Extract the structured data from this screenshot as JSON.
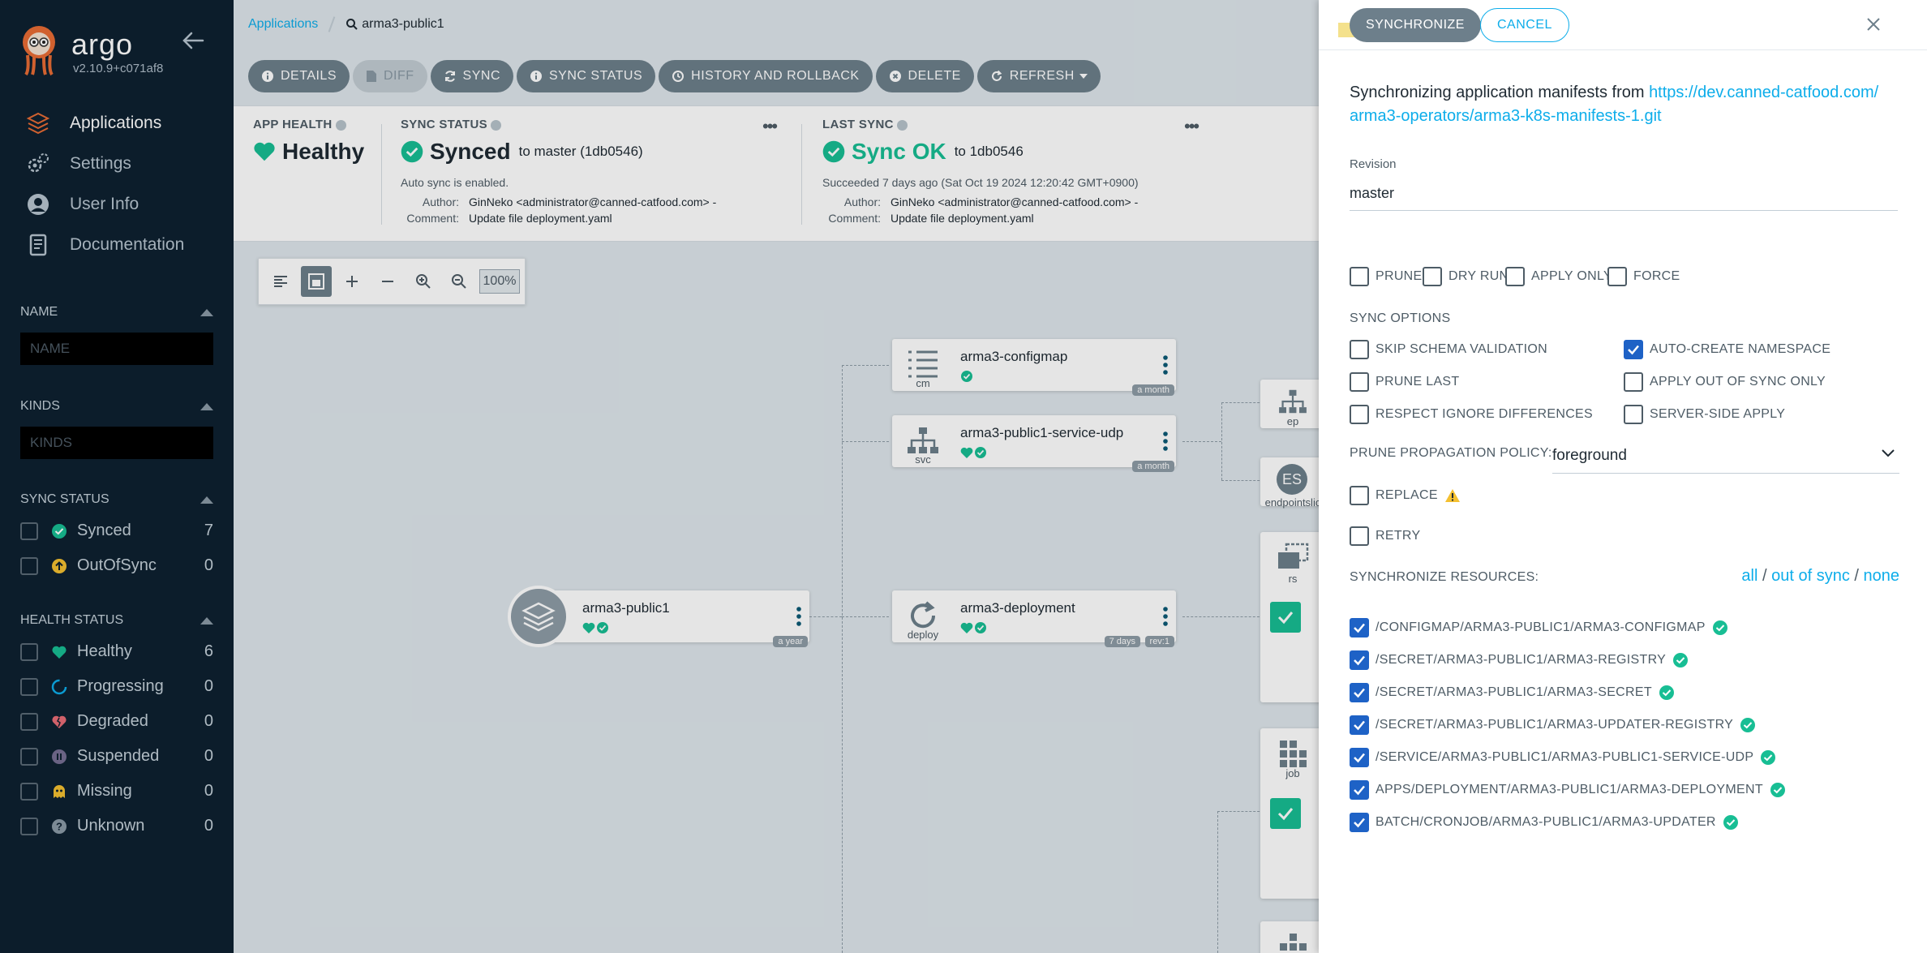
{
  "sidebar": {
    "logo_text": "argo",
    "version": "v2.10.9+c071af8",
    "nav": [
      {
        "label": "Applications"
      },
      {
        "label": "Settings"
      },
      {
        "label": "User Info"
      },
      {
        "label": "Documentation"
      }
    ],
    "name_filter": {
      "title": "NAME",
      "placeholder": "NAME"
    },
    "kinds_filter": {
      "title": "KINDS",
      "placeholder": "KINDS"
    },
    "sync_status": {
      "title": "SYNC STATUS",
      "items": [
        {
          "label": "Synced",
          "count": "7"
        },
        {
          "label": "OutOfSync",
          "count": "0"
        }
      ]
    },
    "health_status": {
      "title": "HEALTH STATUS",
      "items": [
        {
          "label": "Healthy",
          "count": "6"
        },
        {
          "label": "Progressing",
          "count": "0"
        },
        {
          "label": "Degraded",
          "count": "0"
        },
        {
          "label": "Suspended",
          "count": "0"
        },
        {
          "label": "Missing",
          "count": "0"
        },
        {
          "label": "Unknown",
          "count": "0"
        }
      ]
    }
  },
  "breadcrumb": {
    "root": "Applications",
    "app": "arma3-public1"
  },
  "toolbar": {
    "details": "DETAILS",
    "diff": "DIFF",
    "sync": "SYNC",
    "sync_status": "SYNC STATUS",
    "history": "HISTORY AND ROLLBACK",
    "delete": "DELETE",
    "refresh": "REFRESH"
  },
  "status": {
    "app_health": {
      "title": "APP HEALTH",
      "value": "Healthy"
    },
    "sync_status": {
      "title": "SYNC STATUS",
      "value": "Synced",
      "target": "to master (1db0546)",
      "note": "Auto sync is enabled.",
      "author_label": "Author:",
      "author": "GinNeko <administrator@canned-catfood.com> -",
      "comment_label": "Comment:",
      "comment": "Update file deployment.yaml"
    },
    "last_sync": {
      "title": "LAST SYNC",
      "value": "Sync OK",
      "target": "to 1db0546",
      "note": "Succeeded 7 days ago (Sat Oct 19 2024 12:20:42 GMT+0900)",
      "author_label": "Author:",
      "author": "GinNeko <administrator@canned-catfood.com> -",
      "comment_label": "Comment:",
      "comment": "Update file deployment.yaml"
    }
  },
  "graph": {
    "zoom": "100%",
    "nodes": {
      "app": {
        "name": "arma3-public1",
        "age": "a year"
      },
      "configmap": {
        "name": "arma3-configmap",
        "kind": "cm",
        "age": "a month"
      },
      "service": {
        "name": "arma3-public1-service-udp",
        "kind": "svc",
        "age": "a month"
      },
      "deployment": {
        "name": "arma3-deployment",
        "kind": "deploy",
        "age": "7 days",
        "rev": "rev:1"
      },
      "ep": {
        "kind": "ep"
      },
      "endpointslice": {
        "kind": "endpointslic",
        "abbr": "ES"
      },
      "rs": {
        "kind": "rs"
      },
      "job": {
        "kind": "job"
      }
    }
  },
  "drawer": {
    "synchronize_label": "SYNCHRONIZE",
    "cancel_label": "CANCEL",
    "intro": "Synchronizing application manifests from ",
    "repo_url": "https://dev.canned-catfood.com/ arma3-operators/arma3-k8s-manifests-1.git",
    "revision_label": "Revision",
    "revision_value": "master",
    "opts": {
      "prune": "PRUNE",
      "dry_run": "DRY RUN",
      "apply_only": "APPLY ONLY",
      "force": "FORCE"
    },
    "sync_options_title": "SYNC OPTIONS",
    "sync_options": {
      "skip_schema": "SKIP SCHEMA VALIDATION",
      "auto_create_ns": "AUTO-CREATE NAMESPACE",
      "prune_last": "PRUNE LAST",
      "apply_oos": "APPLY OUT OF SYNC ONLY",
      "respect_ignore": "RESPECT IGNORE DIFFERENCES",
      "server_side": "SERVER-SIDE APPLY"
    },
    "ppp_label": "PRUNE PROPAGATION POLICY:",
    "ppp_value": "foreground",
    "replace": "REPLACE",
    "retry": "RETRY",
    "resources_title": "SYNCHRONIZE RESOURCES:",
    "res_all": "all",
    "res_oos": "out of sync",
    "res_none": "none",
    "resources": [
      "/CONFIGMAP/ARMA3-PUBLIC1/ARMA3-CONFIGMAP",
      "/SECRET/ARMA3-PUBLIC1/ARMA3-REGISTRY",
      "/SECRET/ARMA3-PUBLIC1/ARMA3-SECRET",
      "/SECRET/ARMA3-PUBLIC1/ARMA3-UPDATER-REGISTRY",
      "/SERVICE/ARMA3-PUBLIC1/ARMA3-PUBLIC1-SERVICE-UDP",
      "APPS/DEPLOYMENT/ARMA3-PUBLIC1/ARMA3-DEPLOYMENT",
      "BATCH/CRONJOB/ARMA3-PUBLIC1/ARMA3-UPDATER"
    ]
  },
  "colors": {
    "accent": "#0dadea",
    "healthy": "#18be94",
    "checkbox": "#1e62c6",
    "sidebar_bg": "#0e2130"
  }
}
